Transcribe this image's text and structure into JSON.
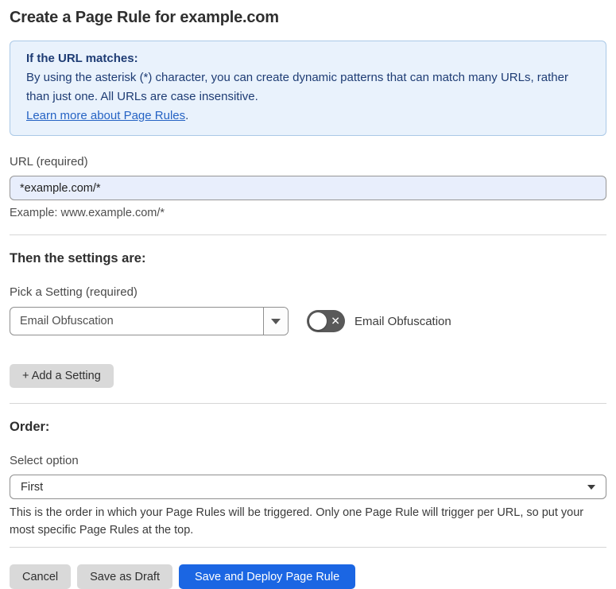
{
  "page": {
    "title": "Create a Page Rule for example.com"
  },
  "info_box": {
    "heading": "If the URL matches:",
    "body": "By using the asterisk (*) character, you can create dynamic patterns that can match many URLs, rather than just one. All URLs are case insensitive.",
    "link_label": "Learn more about Page Rules",
    "link_suffix": "."
  },
  "url_field": {
    "label": "URL (required)",
    "value": "*example.com/*",
    "helper": "Example: www.example.com/*"
  },
  "settings_section": {
    "heading": "Then the settings are:",
    "picker_label": "Pick a Setting (required)",
    "picker_value": "Email Obfuscation",
    "toggle_state": "off",
    "toggle_icon": "✕",
    "toggle_label": "Email Obfuscation",
    "add_setting_label": "+ Add a Setting"
  },
  "order_section": {
    "heading": "Order:",
    "select_label": "Select option",
    "select_value": "First",
    "helper": "This is the order in which your Page Rules will be triggered. Only one Page Rule will trigger per URL, so put your most specific Page Rules at the top."
  },
  "footer": {
    "cancel_label": "Cancel",
    "save_draft_label": "Save as Draft",
    "save_deploy_label": "Save and Deploy Page Rule"
  },
  "colors": {
    "accent_blue": "#1b66e3",
    "info_bg": "#e9f2fc",
    "info_border": "#abc9e7",
    "info_text": "#1e3c74",
    "link_blue": "#2563c4",
    "input_bg": "#e8eefc",
    "toggle_off": "#595959",
    "button_gray": "#d9d9d9"
  }
}
